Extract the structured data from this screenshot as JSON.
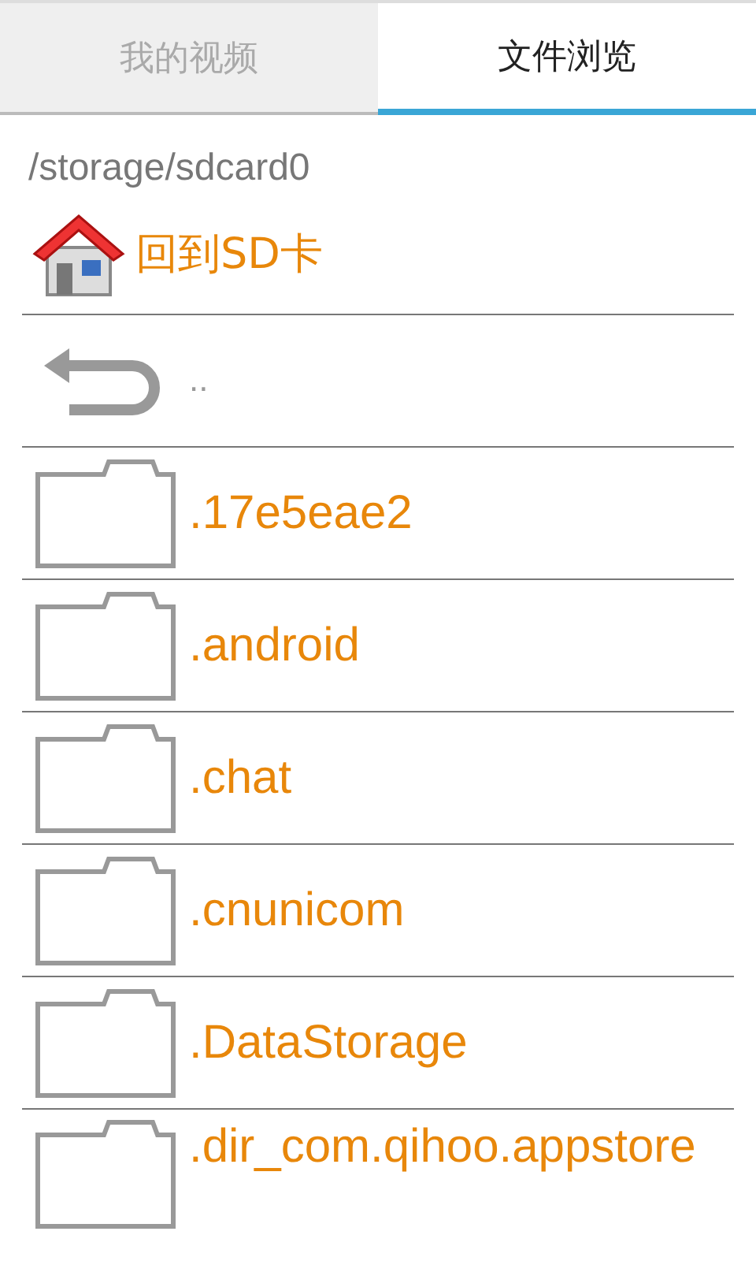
{
  "tabs": [
    {
      "label": "我的视频",
      "selected": false
    },
    {
      "label": "文件浏览",
      "selected": true
    }
  ],
  "path": "/storage/sdcard0",
  "home_link": "回到SD卡",
  "entries": [
    {
      "kind": "up",
      "name": ".."
    },
    {
      "kind": "folder",
      "name": ".17e5eae2"
    },
    {
      "kind": "folder",
      "name": ".android"
    },
    {
      "kind": "folder",
      "name": ".chat"
    },
    {
      "kind": "folder",
      "name": ".cnunicom"
    },
    {
      "kind": "folder",
      "name": ".DataStorage"
    },
    {
      "kind": "folder",
      "name": ".dir_com.qihoo.appstore"
    }
  ]
}
